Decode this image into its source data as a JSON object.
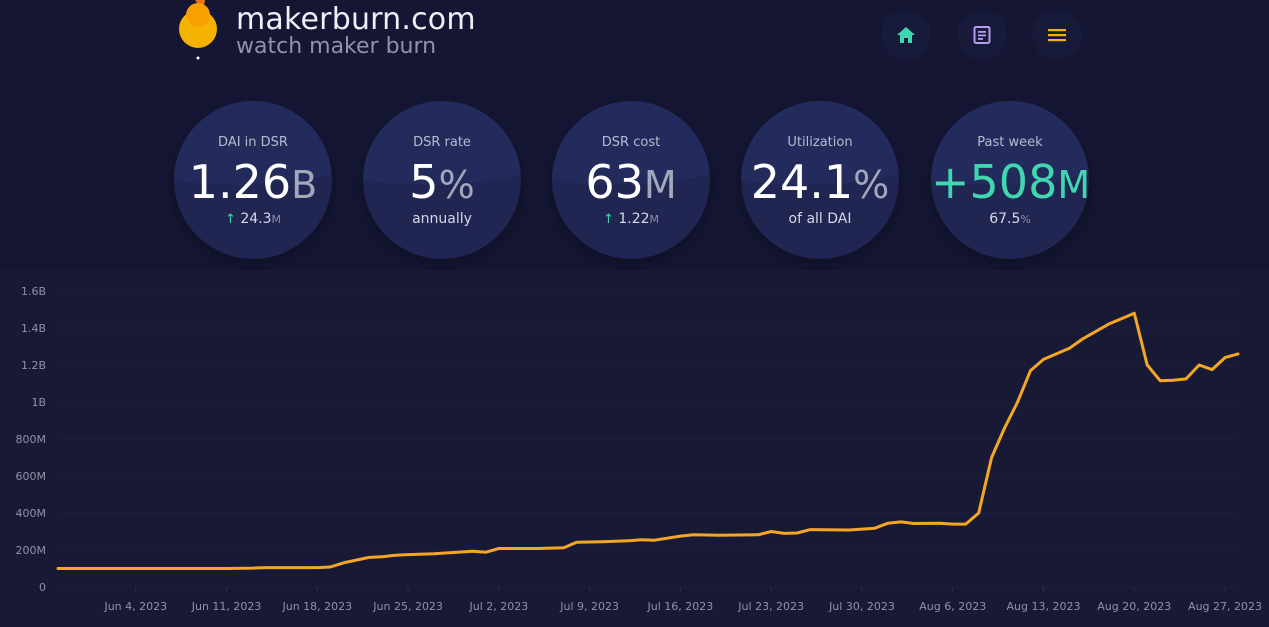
{
  "header": {
    "title": "makerburn.com",
    "subtitle": "watch maker burn",
    "nav": [
      {
        "name": "home-icon",
        "color": "#3fd6b0"
      },
      {
        "name": "document-icon",
        "color": "#b49cf0"
      },
      {
        "name": "menu-icon",
        "color": "#f5b301"
      }
    ]
  },
  "stats": [
    {
      "label": "DAI in DSR",
      "value": "1.26",
      "unit": "B",
      "delta_arrow": "↑",
      "delta": "24.3",
      "delta_unit": "M"
    },
    {
      "label": "DSR rate",
      "value": "5",
      "unit": "%",
      "sub": "annually"
    },
    {
      "label": "DSR cost",
      "value": "63",
      "unit": "M",
      "delta_arrow": "↑",
      "delta": "1.22",
      "delta_unit": "M"
    },
    {
      "label": "Utilization",
      "value": "24.1",
      "unit": "%",
      "sub": "of all DAI"
    },
    {
      "label": "Past week",
      "value": "+508",
      "unit": "M",
      "sub": "67.5",
      "sub_unit": "%"
    }
  ],
  "colors": {
    "background": "#141633",
    "line": "#f5a623",
    "accent_green": "#3fd6b0"
  },
  "chart_data": {
    "type": "line",
    "ylabel": "",
    "xlabel": "",
    "ylim": [
      0,
      1600000000
    ],
    "yticks": [
      {
        "value": 0,
        "label": "0"
      },
      {
        "value": 200000000,
        "label": "200M"
      },
      {
        "value": 400000000,
        "label": "400M"
      },
      {
        "value": 600000000,
        "label": "600M"
      },
      {
        "value": 800000000,
        "label": "800M"
      },
      {
        "value": 1000000000,
        "label": "1B"
      },
      {
        "value": 1200000000,
        "label": "1.2B"
      },
      {
        "value": 1400000000,
        "label": "1.4B"
      },
      {
        "value": 1600000000,
        "label": "1.6B"
      }
    ],
    "xlim": [
      "2023-05-29",
      "2023-08-28"
    ],
    "xticks": [
      {
        "date": "2023-06-04",
        "label": "Jun 4, 2023"
      },
      {
        "date": "2023-06-11",
        "label": "Jun 11, 2023"
      },
      {
        "date": "2023-06-18",
        "label": "Jun 18, 2023"
      },
      {
        "date": "2023-06-25",
        "label": "Jun 25, 2023"
      },
      {
        "date": "2023-07-02",
        "label": "Jul 2, 2023"
      },
      {
        "date": "2023-07-09",
        "label": "Jul 9, 2023"
      },
      {
        "date": "2023-07-16",
        "label": "Jul 16, 2023"
      },
      {
        "date": "2023-07-23",
        "label": "Jul 23, 2023"
      },
      {
        "date": "2023-07-30",
        "label": "Jul 30, 2023"
      },
      {
        "date": "2023-08-06",
        "label": "Aug 6, 2023"
      },
      {
        "date": "2023-08-13",
        "label": "Aug 13, 2023"
      },
      {
        "date": "2023-08-20",
        "label": "Aug 20, 2023"
      },
      {
        "date": "2023-08-27",
        "label": "Aug 27, 2023"
      }
    ],
    "series": [
      {
        "points": [
          [
            "2023-05-29",
            100000000
          ],
          [
            "2023-06-04",
            100000000
          ],
          [
            "2023-06-11",
            100000000
          ],
          [
            "2023-06-13",
            102000000
          ],
          [
            "2023-06-14",
            105000000
          ],
          [
            "2023-06-18",
            105000000
          ],
          [
            "2023-06-19",
            108000000
          ],
          [
            "2023-06-20",
            130000000
          ],
          [
            "2023-06-22",
            160000000
          ],
          [
            "2023-06-23",
            163000000
          ],
          [
            "2023-06-24",
            172000000
          ],
          [
            "2023-06-25",
            175000000
          ],
          [
            "2023-06-27",
            180000000
          ],
          [
            "2023-06-30",
            193000000
          ],
          [
            "2023-07-01",
            188000000
          ],
          [
            "2023-07-02",
            208000000
          ],
          [
            "2023-07-05",
            208000000
          ],
          [
            "2023-07-07",
            212000000
          ],
          [
            "2023-07-08",
            242000000
          ],
          [
            "2023-07-10",
            245000000
          ],
          [
            "2023-07-12",
            250000000
          ],
          [
            "2023-07-13",
            255000000
          ],
          [
            "2023-07-14",
            253000000
          ],
          [
            "2023-07-16",
            275000000
          ],
          [
            "2023-07-17",
            282000000
          ],
          [
            "2023-07-19",
            280000000
          ],
          [
            "2023-07-22",
            282000000
          ],
          [
            "2023-07-23",
            300000000
          ],
          [
            "2023-07-24",
            290000000
          ],
          [
            "2023-07-25",
            292000000
          ],
          [
            "2023-07-26",
            310000000
          ],
          [
            "2023-07-29",
            308000000
          ],
          [
            "2023-07-31",
            318000000
          ],
          [
            "2023-08-01",
            345000000
          ],
          [
            "2023-08-02",
            352000000
          ],
          [
            "2023-08-03",
            343000000
          ],
          [
            "2023-08-05",
            345000000
          ],
          [
            "2023-08-06",
            340000000
          ],
          [
            "2023-08-07",
            340000000
          ],
          [
            "2023-08-08",
            400000000
          ],
          [
            "2023-08-09",
            700000000
          ],
          [
            "2023-08-10",
            860000000
          ],
          [
            "2023-08-11",
            1000000000
          ],
          [
            "2023-08-12",
            1170000000
          ],
          [
            "2023-08-13",
            1230000000
          ],
          [
            "2023-08-15",
            1290000000
          ],
          [
            "2023-08-16",
            1340000000
          ],
          [
            "2023-08-17",
            1380000000
          ],
          [
            "2023-08-18",
            1420000000
          ],
          [
            "2023-08-19",
            1450000000
          ],
          [
            "2023-08-20",
            1480000000
          ],
          [
            "2023-08-21",
            1200000000
          ],
          [
            "2023-08-22",
            1115000000
          ],
          [
            "2023-08-23",
            1118000000
          ],
          [
            "2023-08-24",
            1125000000
          ],
          [
            "2023-08-25",
            1200000000
          ],
          [
            "2023-08-26",
            1175000000
          ],
          [
            "2023-08-27",
            1240000000
          ],
          [
            "2023-08-28",
            1260000000
          ]
        ]
      }
    ]
  }
}
